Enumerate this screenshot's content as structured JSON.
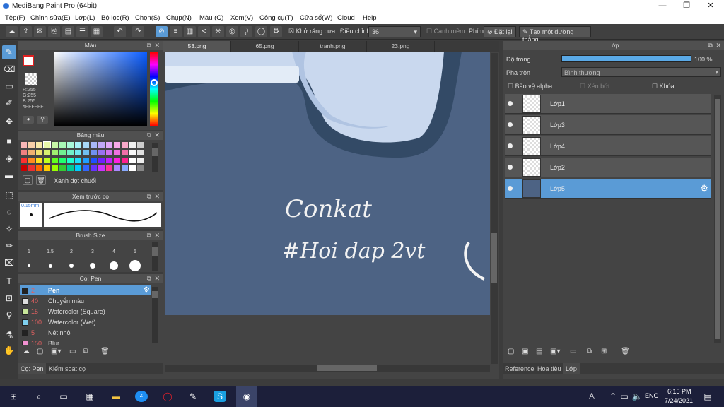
{
  "title": "MediBang Paint Pro (64bit)",
  "menu": [
    "Tệp(F)",
    "Chỉnh sửa(E)",
    "Lớp(L)",
    "Bộ lọc(R)",
    "Chọn(S)",
    "Chụp(N)",
    "Màu (C)",
    "Xem(V)",
    "Công cụ(T)",
    "Cửa sổ(W)",
    "Cloud",
    "Help"
  ],
  "toolbar": {
    "antialias": "Khử răng cưa",
    "adjust": "Điều chỉnh",
    "adjust_value": "36",
    "snap": "Cạnh mềm",
    "key": "Phím",
    "reset": "Đặt lại",
    "make_line": "Tạo một đường thẳng"
  },
  "color_panel": {
    "title": "Màu",
    "r": "R:255",
    "g": "G:255",
    "b": "B:255",
    "hex": "#FFFFFF"
  },
  "palette_panel": {
    "title": "Bảng màu",
    "name": "Xanh đọt chuối"
  },
  "preview_panel": {
    "title": "Xem trước cọ",
    "size": "0.15mm"
  },
  "brushsize_panel": {
    "title": "Brush Size",
    "sizes": [
      "1",
      "1.5",
      "2",
      "3",
      "4",
      "5"
    ]
  },
  "brush_panel": {
    "title": "Cọ: Pen",
    "items": [
      {
        "num": "2",
        "name": "Pen",
        "color": "#222222"
      },
      {
        "num": "40",
        "name": "Chuyển màu",
        "color": "#dddddd"
      },
      {
        "num": "15",
        "name": "Watercolor (Square)",
        "color": "#c8e69a"
      },
      {
        "num": "100",
        "name": "Watercolor (Wet)",
        "color": "#7fd0ef"
      },
      {
        "num": "5",
        "name": "Nét nhỏ",
        "color": "#222222"
      },
      {
        "num": "150",
        "name": "Blur",
        "color": "#f090d0"
      }
    ],
    "tab1": "Cọ: Pen",
    "tab2": "Kiểm soát cọ"
  },
  "tabs": [
    "53.png",
    "65.png",
    "tranh.png",
    "23.png"
  ],
  "canvas": {
    "text1": "Conkat",
    "text2": "#Hoi dap 2vt"
  },
  "layer_panel": {
    "title": "Lớp",
    "opacity_label": "Độ trong",
    "opacity": "100 %",
    "blend_label": "Pha trộn",
    "blend": "Bình thường",
    "protect_alpha": "Bảo vệ alpha",
    "clipping": "Xén bớt",
    "lock": "Khóa",
    "layers": [
      "Lớp1",
      "Lớp3",
      "Lớp4",
      "Lớp2",
      "Lớp5"
    ],
    "tabs": [
      "Reference",
      "Hoa tiêu",
      "Lớp"
    ]
  },
  "taskbar": {
    "lang": "ENG",
    "time": "6:15 PM",
    "date": "7/24/2021"
  },
  "colors": {
    "accent": "#5a9bd6",
    "canvas_bg": "#4d6384"
  }
}
